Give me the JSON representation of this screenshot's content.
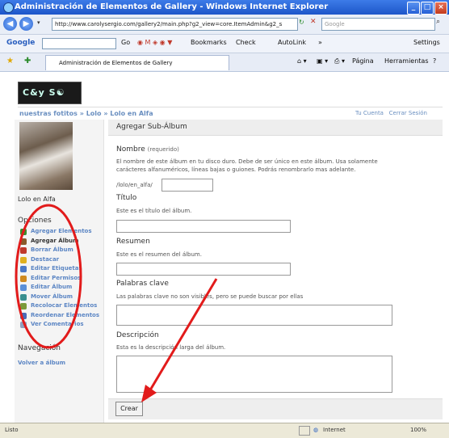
{
  "window": {
    "title": "Administración de Elementos de Gallery - Windows Internet Explorer",
    "min": "_",
    "max": "□",
    "close": "×"
  },
  "address": {
    "url": "http://www.carolysergio.com/gallery2/main.php?g2_view=core.ItemAdmin&g2_s",
    "search_placeholder": "Google"
  },
  "google_toolbar": {
    "label": "Google",
    "go": "Go",
    "bookmarks": "Bookmarks",
    "check": "Check",
    "autolink": "AutoLink",
    "more": "»",
    "settings": "Settings"
  },
  "ie_toolbar": {
    "tab_title": "Administración de Elementos de Gallery",
    "pagina": "Página",
    "herramientas": "Herramientas"
  },
  "site": {
    "logo": "C&y S☯"
  },
  "breadcrumb": {
    "items": [
      "nuestras fotitos",
      "Lolo",
      "Lolo en Alfa"
    ],
    "sep": "»"
  },
  "toplinks": {
    "account": "Tu Cuenta",
    "logout": "Cerrar Sesión"
  },
  "sidebar": {
    "caption": "Lolo en Alfa",
    "options_heading": "Opciones",
    "options": [
      {
        "label": "Agregar Elementos",
        "color": "#3a8f2e"
      },
      {
        "label": "Agregar Álbum",
        "color": "#8a5a2b"
      },
      {
        "label": "Borrar Álbum",
        "color": "#c0392b"
      },
      {
        "label": "Destacar",
        "color": "#e0b020"
      },
      {
        "label": "Editar Etiquetas",
        "color": "#4a78c8"
      },
      {
        "label": "Editar Permisos",
        "color": "#d08a20"
      },
      {
        "label": "Editar Álbum",
        "color": "#5a8fd8"
      },
      {
        "label": "Mover Álbum",
        "color": "#3a8f8f"
      },
      {
        "label": "Recolocar Elementos",
        "color": "#7a9a3a"
      },
      {
        "label": "Reordenar Elementos",
        "color": "#4a6ab8"
      },
      {
        "label": "Ver Comentarios",
        "color": "#8fa0c0"
      }
    ],
    "nav_heading": "Navegación",
    "nav_link": "Volver a álbum"
  },
  "form": {
    "heading": "Agregar Sub-Álbum",
    "name_label": "Nombre",
    "name_req": "(requerido)",
    "name_desc1": "El nombre de este álbum en tu disco duro. Debe de ser único en este álbum. Usa solamente",
    "name_desc2": "carácteres alfanuméricos, líneas bajas o guiones. Podrás renombrarlo mas adelante.",
    "path_prefix": "/lolo/en_alfa/",
    "title_label": "Título",
    "title_desc": "Este es el título del álbum.",
    "summary_label": "Resumen",
    "summary_desc": "Este es el resumen del álbum.",
    "keywords_label": "Palabras clave",
    "keywords_desc": "Las palabras clave no son visibles, pero se puede buscar por ellas",
    "desc_label": "Descripción",
    "desc_desc": "Esta es la descripción larga del álbum.",
    "submit": "Crear"
  },
  "status": {
    "left": "Listo",
    "zone": "Internet",
    "zoom": "100%"
  },
  "annotation_color": "#e21b1b"
}
